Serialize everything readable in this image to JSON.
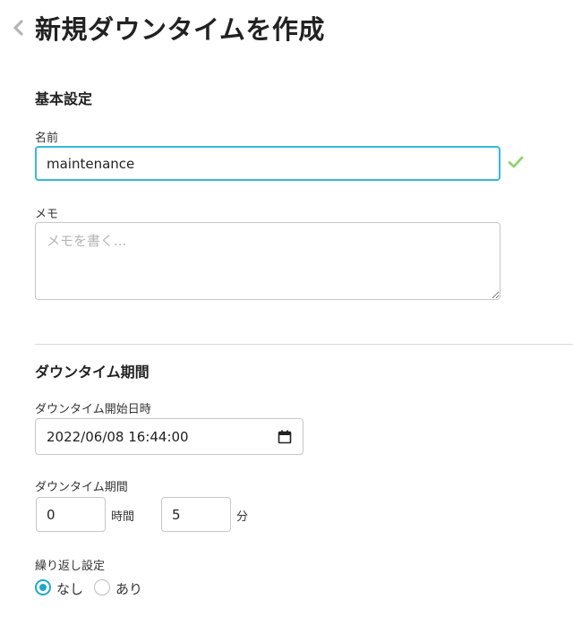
{
  "header": {
    "title": "新規ダウンタイムを作成",
    "back_icon": "chevron-left-icon"
  },
  "basic_settings": {
    "section_title": "基本設定",
    "name": {
      "label": "名前",
      "value": "maintenance",
      "valid_icon": "check-icon",
      "valid_color": "#8ed36b"
    },
    "memo": {
      "label": "メモ",
      "placeholder": "メモを書く...",
      "value": ""
    }
  },
  "downtime_period": {
    "section_title": "ダウンタイム期間",
    "start": {
      "label": "ダウンタイム開始日時",
      "value": "2022/06/08 16:44:00",
      "icon": "calendar-icon"
    },
    "duration": {
      "label": "ダウンタイム期間",
      "hours_value": "0",
      "hours_unit": "時間",
      "minutes_value": "5",
      "minutes_unit": "分"
    },
    "recurrence": {
      "label": "繰り返し設定",
      "options": [
        {
          "label": "なし",
          "checked": true
        },
        {
          "label": "あり",
          "checked": false
        }
      ]
    }
  },
  "colors": {
    "accent": "#1fa9c9",
    "focus_border": "#38b8d8",
    "border": "#c7c7c7",
    "text": "#222222"
  }
}
